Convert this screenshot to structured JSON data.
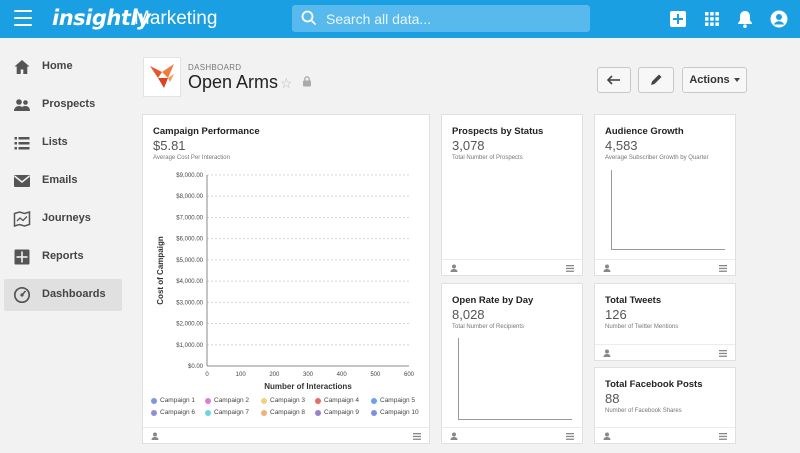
{
  "app": {
    "logo": "insightly",
    "title": "Marketing"
  },
  "search": {
    "placeholder": "Search all data..."
  },
  "colors": {
    "topbar": "#1b9fe3",
    "accent_orange": "#e8552b"
  },
  "sidebar": {
    "items": [
      {
        "label": "Home",
        "icon": "home-icon",
        "active": false
      },
      {
        "label": "Prospects",
        "icon": "people-icon",
        "active": false
      },
      {
        "label": "Lists",
        "icon": "list-icon",
        "active": false
      },
      {
        "label": "Emails",
        "icon": "email-icon",
        "active": false
      },
      {
        "label": "Journeys",
        "icon": "map-icon",
        "active": false
      },
      {
        "label": "Reports",
        "icon": "reports-icon",
        "active": false
      },
      {
        "label": "Dashboards",
        "icon": "dashboard-icon",
        "active": true
      }
    ]
  },
  "dashboard": {
    "kicker": "DASHBOARD",
    "title": "Open Arms",
    "actions_label": "Actions"
  },
  "cards": {
    "campaign": {
      "title": "Campaign Performance",
      "value": "$5.81",
      "sub": "Average Cost Per Interaction"
    },
    "prospects": {
      "title": "Prospects by Status",
      "value": "3,078",
      "sub": "Total Number of Prospects"
    },
    "audience": {
      "title": "Audience Growth",
      "value": "4,583",
      "sub": "Average Subscriber Growth by Quarter"
    },
    "openrate": {
      "title": "Open Rate by Day",
      "value": "8,028",
      "sub": "Total Number of Recipients"
    },
    "tweets": {
      "title": "Total Tweets",
      "value": "126",
      "sub": "Number of Twitter Mentions"
    },
    "facebook": {
      "title": "Total Facebook Posts",
      "value": "88",
      "sub": "Number of Facebook Shares"
    }
  },
  "chart_data": {
    "type": "scatter",
    "title": "Campaign Performance",
    "xlabel": "Number of Interactions",
    "ylabel": "Cost of Campaign",
    "xlim": [
      0,
      600
    ],
    "ylim": [
      0,
      9000
    ],
    "x_ticks": [
      "0",
      "100",
      "200",
      "300",
      "400",
      "500",
      "600"
    ],
    "y_ticks": [
      "$0.00",
      "$1,000.00",
      "$2,000.00",
      "$3,000.00",
      "$4,000.00",
      "$5,000.00",
      "$6,000.00",
      "$7,000.00",
      "$8,000.00",
      "$9,000.00"
    ],
    "grid": true,
    "legend_position": "bottom",
    "series": [
      {
        "name": "Campaign 1",
        "color": "#7d9ad8"
      },
      {
        "name": "Campaign 2",
        "color": "#e37bd3"
      },
      {
        "name": "Campaign 3",
        "color": "#f1d27a"
      },
      {
        "name": "Campaign 4",
        "color": "#e56b6b"
      },
      {
        "name": "Campaign 5",
        "color": "#6aa3e6"
      },
      {
        "name": "Campaign 6",
        "color": "#8f8fd6"
      },
      {
        "name": "Campaign 7",
        "color": "#6ed3e3"
      },
      {
        "name": "Campaign 8",
        "color": "#f0b27a"
      },
      {
        "name": "Campaign 9",
        "color": "#9a7fd1"
      },
      {
        "name": "Campaign 10",
        "color": "#7f8fe6"
      }
    ]
  }
}
